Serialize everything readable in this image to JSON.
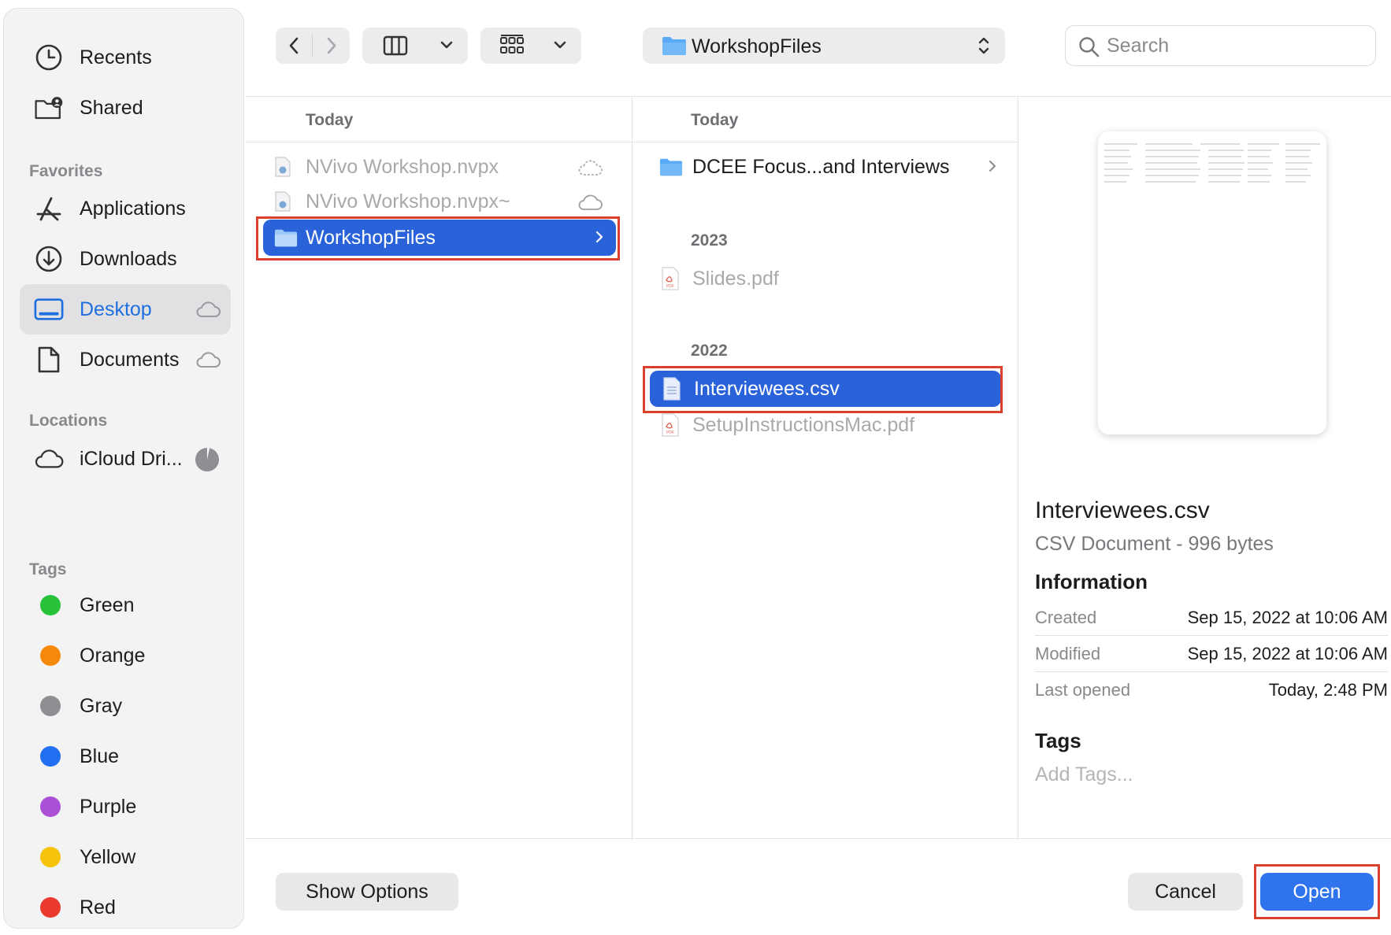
{
  "sidebar": {
    "items": [
      {
        "label": "Recents"
      },
      {
        "label": "Shared"
      }
    ],
    "favorites_header": "Favorites",
    "favorites": [
      {
        "label": "Applications"
      },
      {
        "label": "Downloads"
      },
      {
        "label": "Desktop"
      },
      {
        "label": "Documents"
      }
    ],
    "locations_header": "Locations",
    "locations": [
      {
        "label": "iCloud Dri..."
      }
    ],
    "tags_header": "Tags",
    "tags": [
      {
        "label": "Green",
        "color": "#27c23a"
      },
      {
        "label": "Orange",
        "color": "#f5890c"
      },
      {
        "label": "Gray",
        "color": "#8e8e93"
      },
      {
        "label": "Blue",
        "color": "#1f6ff0"
      },
      {
        "label": "Purple",
        "color": "#a94fd6"
      },
      {
        "label": "Yellow",
        "color": "#f5c30a"
      },
      {
        "label": "Red",
        "color": "#ea3a2e"
      }
    ]
  },
  "toolbar": {
    "location": "WorkshopFiles",
    "search_placeholder": "Search"
  },
  "columns": [
    {
      "header": "Today",
      "rows": [
        {
          "label": "NVivo Workshop.nvpx"
        },
        {
          "label": "NVivo Workshop.nvpx~"
        },
        {
          "label": "WorkshopFiles"
        }
      ]
    },
    {
      "header": "Today",
      "rows": [
        {
          "label": "DCEE Focus...and Interviews"
        }
      ],
      "group_2023": "2023",
      "rows_2023": [
        {
          "label": "Slides.pdf"
        }
      ],
      "group_2022": "2022",
      "rows_2022": [
        {
          "label": "Interviewees.csv"
        },
        {
          "label": "SetupInstructionsMac.pdf"
        }
      ]
    }
  ],
  "preview": {
    "name": "Interviewees.csv",
    "kind": "CSV Document - 996 bytes",
    "info_header": "Information",
    "info": [
      {
        "key": "Created",
        "value": "Sep 15, 2022 at 10:06 AM"
      },
      {
        "key": "Modified",
        "value": "Sep 15, 2022 at 10:06 AM"
      },
      {
        "key": "Last opened",
        "value": "Today, 2:48 PM"
      }
    ],
    "tags_header": "Tags",
    "add_tags": "Add Tags..."
  },
  "buttons": {
    "show_options": "Show Options",
    "cancel": "Cancel",
    "open": "Open"
  },
  "colors": {
    "accent": "#2962d9",
    "highlight_box": "#d9412d",
    "sidebar_active_text": "#1f6fe0"
  }
}
